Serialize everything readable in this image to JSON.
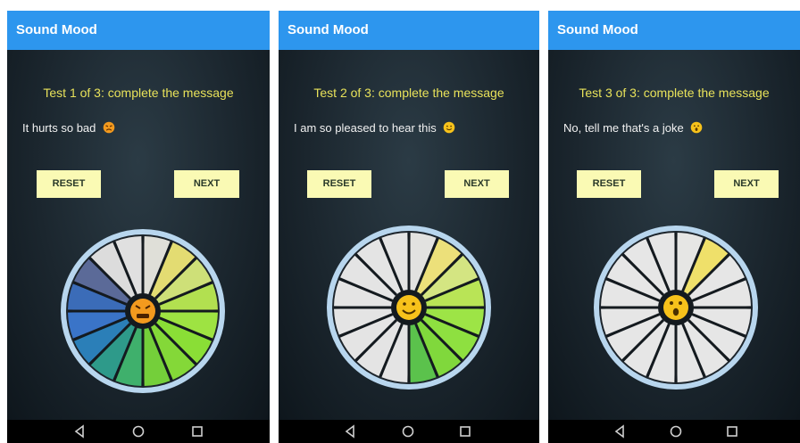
{
  "screens": [
    {
      "app_title": "Sound Mood",
      "test_title": "Test 1 of 3: complete the message",
      "message": "It hurts so bad",
      "mood": "angry",
      "emoji_icon": "angry-face-icon",
      "reset_label": "RESET",
      "next_label": "NEXT",
      "wheel_slices": [
        {
          "color": "#dfdfd8",
          "fill": 1
        },
        {
          "color": "#e3dc72",
          "fill": 1
        },
        {
          "color": "#cee078",
          "fill": 1
        },
        {
          "color": "#b2e050",
          "fill": 1
        },
        {
          "color": "#9ee342",
          "fill": 1
        },
        {
          "color": "#8ade36",
          "fill": 1
        },
        {
          "color": "#84d838",
          "fill": 1
        },
        {
          "color": "#74cf3a",
          "fill": 1
        },
        {
          "color": "#3fb06c",
          "fill": 1
        },
        {
          "color": "#2e9a8a",
          "fill": 1
        },
        {
          "color": "#2b7fb8",
          "fill": 1
        },
        {
          "color": "#3a74c8",
          "fill": 1
        },
        {
          "color": "#3b6cb8",
          "fill": 1
        },
        {
          "color": "#5b6a98",
          "fill": 1
        },
        {
          "color": "#dcdcdc",
          "fill": 1
        },
        {
          "color": "#e0e0e0",
          "fill": 1
        }
      ]
    },
    {
      "app_title": "Sound Mood",
      "test_title": "Test 2 of 3: complete the message",
      "message": "I am so pleased to hear this",
      "mood": "happy",
      "emoji_icon": "smiling-face-icon",
      "reset_label": "RESET",
      "next_label": "NEXT",
      "wheel_slices": [
        {
          "color": "#e2e2e0",
          "fill": 1
        },
        {
          "color": "#ece07a",
          "fill": 1
        },
        {
          "color": "#d4e582",
          "fill": 1
        },
        {
          "color": "#b9e456",
          "fill": 1
        },
        {
          "color": "#9de446",
          "fill": 1
        },
        {
          "color": "#8ee040",
          "fill": 1
        },
        {
          "color": "#80d83c",
          "fill": 1
        },
        {
          "color": "#5bc24c",
          "fill": 1
        },
        {
          "color": "#e4e4e4",
          "fill": 1
        },
        {
          "color": "#e4e4e4",
          "fill": 1
        },
        {
          "color": "#e4e4e4",
          "fill": 1
        },
        {
          "color": "#e4e4e4",
          "fill": 1
        },
        {
          "color": "#e4e4e4",
          "fill": 1
        },
        {
          "color": "#e4e4e4",
          "fill": 1
        },
        {
          "color": "#e4e4e4",
          "fill": 1
        },
        {
          "color": "#e4e4e4",
          "fill": 1
        }
      ]
    },
    {
      "app_title": "Sound Mood",
      "test_title": "Test 3 of 3: complete the message",
      "message": "No, tell me that's a joke",
      "mood": "surprised",
      "emoji_icon": "astonished-face-icon",
      "reset_label": "RESET",
      "next_label": "NEXT",
      "wheel_slices": [
        {
          "color": "#e6e6e4",
          "fill": 1
        },
        {
          "color": "#efe06a",
          "fill": 1
        },
        {
          "color": "#e6e6e6",
          "fill": 1
        },
        {
          "color": "#e6e6e6",
          "fill": 1
        },
        {
          "color": "#e6e6e6",
          "fill": 1
        },
        {
          "color": "#e6e6e6",
          "fill": 1
        },
        {
          "color": "#e6e6e6",
          "fill": 1
        },
        {
          "color": "#e6e6e6",
          "fill": 1
        },
        {
          "color": "#e6e6e6",
          "fill": 1
        },
        {
          "color": "#e6e6e6",
          "fill": 1
        },
        {
          "color": "#e6e6e6",
          "fill": 1
        },
        {
          "color": "#e6e6e6",
          "fill": 1
        },
        {
          "color": "#e6e6e6",
          "fill": 1
        },
        {
          "color": "#e6e6e6",
          "fill": 1
        },
        {
          "color": "#e6e6e6",
          "fill": 1
        },
        {
          "color": "#e6e6e6",
          "fill": 1
        }
      ]
    }
  ],
  "nav_icons": [
    "back-triangle-icon",
    "home-circle-icon",
    "recents-square-icon"
  ],
  "colors": {
    "appbar": "#2d96ee",
    "title_text": "#e8e25a",
    "button_bg": "#fafab4",
    "emoji": "#f7c21b",
    "wheel_rim": "#b8d6ee"
  }
}
